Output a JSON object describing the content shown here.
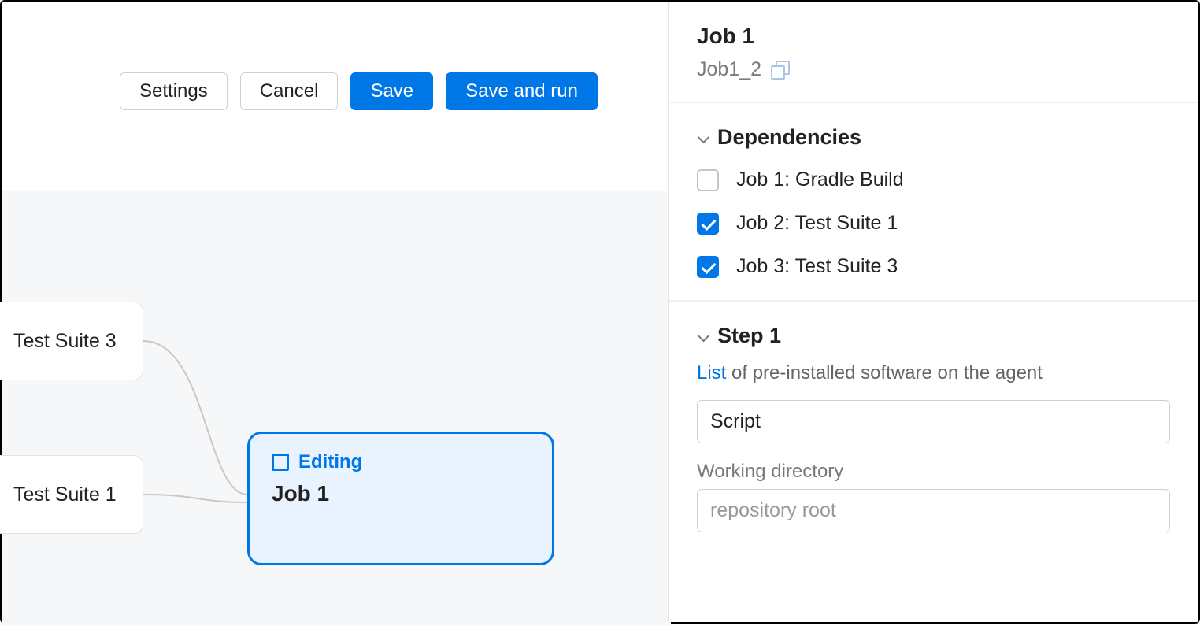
{
  "toolbar": {
    "settings": "Settings",
    "cancel": "Cancel",
    "save": "Save",
    "save_and_run": "Save and run"
  },
  "canvas": {
    "node_top": "Test Suite 3",
    "node_bottom": "Test Suite 1",
    "editing_badge": "Editing",
    "editing_title": "Job 1"
  },
  "panel": {
    "title": "Job 1",
    "subtitle": "Job1_2",
    "dependencies": {
      "title": "Dependencies",
      "items": [
        {
          "label": "Job 1: Gradle Build",
          "checked": false
        },
        {
          "label": "Job 2: Test Suite 1",
          "checked": true
        },
        {
          "label": "Job 3: Test Suite 3",
          "checked": true
        }
      ]
    },
    "step": {
      "title": "Step 1",
      "hint_link": "List",
      "hint_rest": " of pre-installed software on the agent",
      "type_value": "Script",
      "working_dir_label": "Working directory",
      "working_dir_placeholder": "repository root"
    }
  }
}
